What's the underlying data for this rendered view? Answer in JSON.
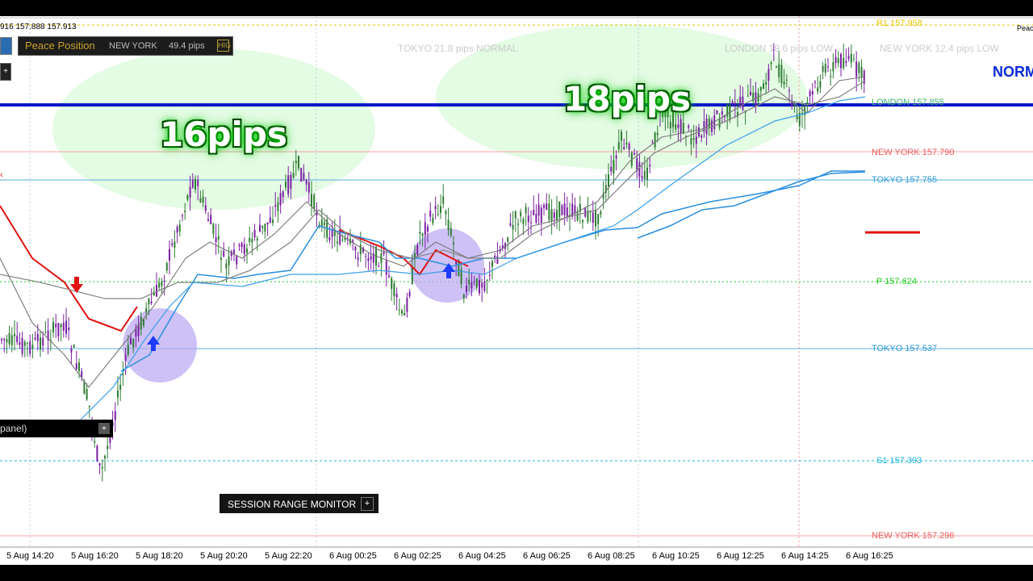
{
  "ohlc_text": "916 157.888 157.913",
  "info_panel": {
    "title": "Peace Position",
    "session": "NEW YORK",
    "pips": "49.4 pips",
    "tag": "HIG"
  },
  "callouts": {
    "left": "16pips",
    "right": "18pips"
  },
  "session_stats": [
    {
      "text": "TOKYO  21.8 pips  NORMAL"
    },
    {
      "text": "LONDON  19.6 pips  LOW"
    },
    {
      "text": "NEW YORK  12.4 pips  LOW"
    }
  ],
  "levels": [
    {
      "label": "R1 157.958",
      "color": "#e6c600"
    },
    {
      "label": "LONDON 157.855",
      "color": "#3cb371"
    },
    {
      "label": "NEW YORK 157.790",
      "color": "#ef5b5b"
    },
    {
      "label": "TOKYO 157.755",
      "color": "#2f9bd6"
    },
    {
      "label": "P 157.624",
      "color": "#22cc22"
    },
    {
      "label": "TOKYO 157.537",
      "color": "#2f9bd6"
    },
    {
      "label": "S1 157.393",
      "color": "#19b5d8"
    },
    {
      "label": "NEW YORK 157.296",
      "color": "#ef5b5b"
    }
  ],
  "norm_label": "NORM",
  "peac_label": "Peac",
  "panel_tab_label": "panel)",
  "panel_tab_plus": "+",
  "session_monitor": {
    "label": "SESSION RANGE MONITOR",
    "plus": "+"
  },
  "left_btn_label": "+",
  "time_axis": [
    "5 Aug 14:20",
    "5 Aug 16:20",
    "5 Aug 18:20",
    "5 Aug 20:20",
    "5 Aug 22:20",
    "6 Aug 00:25",
    "6 Aug 02:25",
    "6 Aug 04:25",
    "6 Aug 06:25",
    "6 Aug 08:25",
    "6 Aug 10:25",
    "6 Aug 12:25",
    "6 Aug 14:25",
    "6 Aug 16:25"
  ],
  "colors": {
    "bull_candle": "#2e7d32",
    "bear_candle": "#7b1fa2",
    "buy_arrow": "#1e3cff",
    "sell_arrow": "#e01010",
    "resistance_line": "#0018c8",
    "signal_circle": "#b9a6f2"
  }
}
